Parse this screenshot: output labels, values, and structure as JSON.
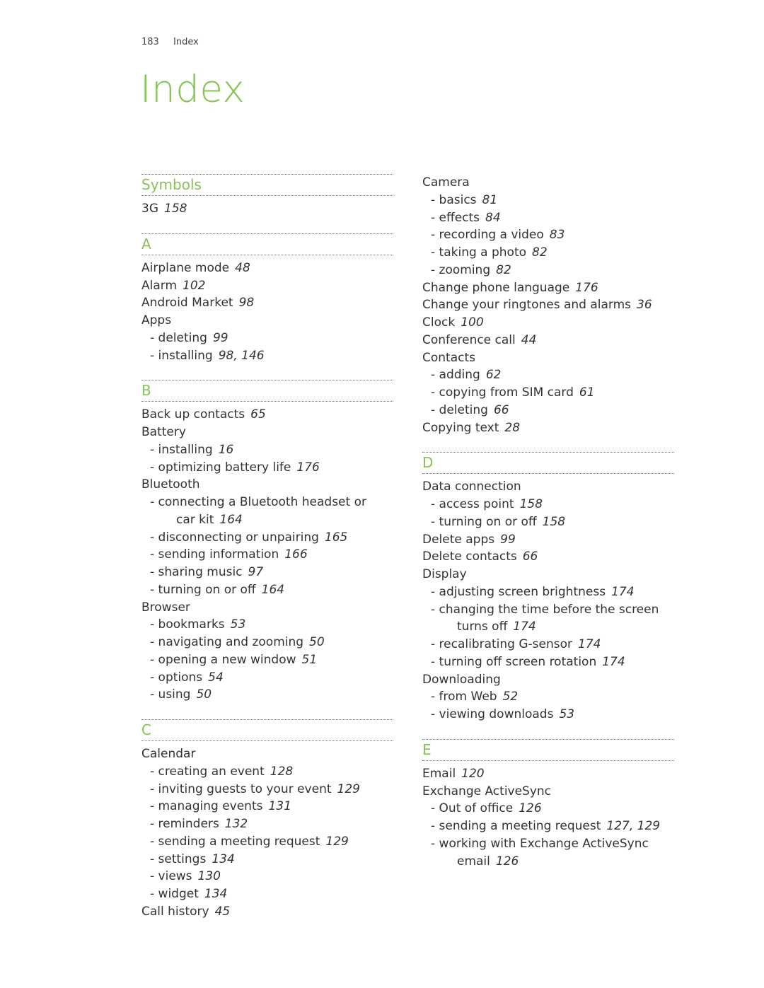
{
  "running_head": {
    "page_number": "183",
    "section": "Index"
  },
  "title": "Index",
  "accent_color": "#86c454",
  "columns": [
    {
      "sections": [
        {
          "heading": "Symbols",
          "entries": [
            {
              "text": "3G",
              "pages": "158",
              "level": 0
            }
          ]
        },
        {
          "heading": "A",
          "entries": [
            {
              "text": "Airplane mode",
              "pages": "48",
              "level": 0
            },
            {
              "text": "Alarm",
              "pages": "102",
              "level": 0
            },
            {
              "text": "Android Market",
              "pages": "98",
              "level": 0
            },
            {
              "text": "Apps",
              "pages": "",
              "level": 0
            },
            {
              "text": "- deleting",
              "pages": "99",
              "level": 1
            },
            {
              "text": "- installing",
              "pages": "98, 146",
              "level": 1
            }
          ]
        },
        {
          "heading": "B",
          "entries": [
            {
              "text": "Back up contacts",
              "pages": "65",
              "level": 0
            },
            {
              "text": "Battery",
              "pages": "",
              "level": 0
            },
            {
              "text": "- installing",
              "pages": "16",
              "level": 1
            },
            {
              "text": "- optimizing battery life",
              "pages": "176",
              "level": 1
            },
            {
              "text": "Bluetooth",
              "pages": "",
              "level": 0
            },
            {
              "text": "- connecting a Bluetooth headset or",
              "continuation": "car kit",
              "pages": "164",
              "level": 1
            },
            {
              "text": "- disconnecting or unpairing",
              "pages": "165",
              "level": 1
            },
            {
              "text": "- sending information",
              "pages": "166",
              "level": 1
            },
            {
              "text": "- sharing music",
              "pages": "97",
              "level": 1
            },
            {
              "text": "- turning on or off",
              "pages": "164",
              "level": 1
            },
            {
              "text": "Browser",
              "pages": "",
              "level": 0
            },
            {
              "text": "- bookmarks",
              "pages": "53",
              "level": 1
            },
            {
              "text": "- navigating and zooming",
              "pages": "50",
              "level": 1
            },
            {
              "text": "- opening a new window",
              "pages": "51",
              "level": 1
            },
            {
              "text": "- options",
              "pages": "54",
              "level": 1
            },
            {
              "text": "- using",
              "pages": "50",
              "level": 1
            }
          ]
        },
        {
          "heading": "C",
          "entries": [
            {
              "text": "Calendar",
              "pages": "",
              "level": 0
            },
            {
              "text": "- creating an event",
              "pages": "128",
              "level": 1
            },
            {
              "text": "- inviting guests to your event",
              "pages": "129",
              "level": 1
            },
            {
              "text": "- managing events",
              "pages": "131",
              "level": 1
            },
            {
              "text": "- reminders",
              "pages": "132",
              "level": 1
            },
            {
              "text": "- sending a meeting request",
              "pages": "129",
              "level": 1
            },
            {
              "text": "- settings",
              "pages": "134",
              "level": 1
            },
            {
              "text": "- views",
              "pages": "130",
              "level": 1
            },
            {
              "text": "- widget",
              "pages": "134",
              "level": 1
            },
            {
              "text": "Call history",
              "pages": "45",
              "level": 0
            }
          ]
        }
      ]
    },
    {
      "sections": [
        {
          "heading": "",
          "entries": [
            {
              "text": "Camera",
              "pages": "",
              "level": 0
            },
            {
              "text": "- basics",
              "pages": "81",
              "level": 1
            },
            {
              "text": "- effects",
              "pages": "84",
              "level": 1
            },
            {
              "text": "- recording a video",
              "pages": "83",
              "level": 1
            },
            {
              "text": "- taking a photo",
              "pages": "82",
              "level": 1
            },
            {
              "text": "- zooming",
              "pages": "82",
              "level": 1
            },
            {
              "text": "Change phone language",
              "pages": "176",
              "level": 0
            },
            {
              "text": "Change your ringtones and alarms",
              "pages": "36",
              "level": 0
            },
            {
              "text": "Clock",
              "pages": "100",
              "level": 0
            },
            {
              "text": "Conference call",
              "pages": "44",
              "level": 0
            },
            {
              "text": "Contacts",
              "pages": "",
              "level": 0
            },
            {
              "text": "- adding",
              "pages": "62",
              "level": 1
            },
            {
              "text": "- copying from SIM card",
              "pages": "61",
              "level": 1
            },
            {
              "text": "- deleting",
              "pages": "66",
              "level": 1
            },
            {
              "text": "Copying text",
              "pages": "28",
              "level": 0
            }
          ]
        },
        {
          "heading": "D",
          "entries": [
            {
              "text": "Data connection",
              "pages": "",
              "level": 0
            },
            {
              "text": "- access point",
              "pages": "158",
              "level": 1
            },
            {
              "text": "- turning on or off",
              "pages": "158",
              "level": 1
            },
            {
              "text": "Delete apps",
              "pages": "99",
              "level": 0
            },
            {
              "text": "Delete contacts",
              "pages": "66",
              "level": 0
            },
            {
              "text": "Display",
              "pages": "",
              "level": 0
            },
            {
              "text": "- adjusting screen brightness",
              "pages": "174",
              "level": 1
            },
            {
              "text": "- changing the time before the screen",
              "continuation": "turns off",
              "pages": "174",
              "level": 1
            },
            {
              "text": "- recalibrating G-sensor",
              "pages": "174",
              "level": 1
            },
            {
              "text": "- turning off screen rotation",
              "pages": "174",
              "level": 1
            },
            {
              "text": "Downloading",
              "pages": "",
              "level": 0
            },
            {
              "text": "- from Web",
              "pages": "52",
              "level": 1
            },
            {
              "text": "- viewing downloads",
              "pages": "53",
              "level": 1
            }
          ]
        },
        {
          "heading": "E",
          "entries": [
            {
              "text": "Email",
              "pages": "120",
              "level": 0
            },
            {
              "text": "Exchange ActiveSync",
              "pages": "",
              "level": 0
            },
            {
              "text": "- Out of office",
              "pages": "126",
              "level": 1
            },
            {
              "text": "- sending a meeting request",
              "pages": "127, 129",
              "level": 1
            },
            {
              "text": "- working with Exchange ActiveSync",
              "continuation": "email",
              "pages": "126",
              "level": 1
            }
          ]
        }
      ]
    }
  ]
}
